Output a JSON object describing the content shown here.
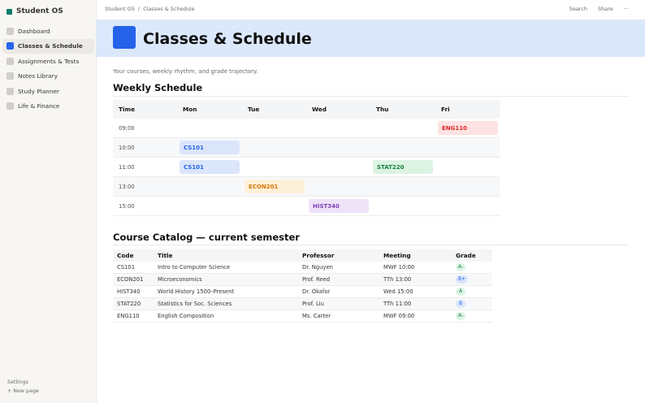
{
  "workspace": {
    "name": "Student OS"
  },
  "sidebar": {
    "items": [
      {
        "label": "Dashboard",
        "active": false
      },
      {
        "label": "Classes & Schedule",
        "active": true
      },
      {
        "label": "Assignments & Tests",
        "active": false
      },
      {
        "label": "Notes Library",
        "active": false
      },
      {
        "label": "Study Planner",
        "active": false
      },
      {
        "label": "Life & Finance",
        "active": false
      }
    ],
    "settings_label": "Settings",
    "new_page_label": "+  New page"
  },
  "topbar": {
    "breadcrumb": [
      "Student OS",
      "/",
      "Classes & Schedule"
    ],
    "search_label": "Search",
    "share_label": "Share",
    "more_label": "···"
  },
  "page": {
    "title": "Classes & Schedule",
    "subtitle": "Your courses, weekly rhythm, and grade trajectory."
  },
  "schedule": {
    "heading": "Weekly Schedule",
    "columns": [
      "Time",
      "Mon",
      "Tue",
      "Wed",
      "Thu",
      "Fri"
    ],
    "rows": [
      {
        "time": "09:00",
        "slots": [
          {
            "day": "Fri",
            "label": "ENG110",
            "color": "#dc2626",
            "bg": "#fde2e2"
          }
        ]
      },
      {
        "time": "10:00",
        "slots": [
          {
            "day": "Mon",
            "label": "CS101",
            "color": "#2563eb",
            "bg": "#dbe6fb"
          }
        ]
      },
      {
        "time": "11:00",
        "slots": [
          {
            "day": "Mon",
            "label": "CS101",
            "color": "#2563eb",
            "bg": "#dbe6fb"
          },
          {
            "day": "Thu",
            "label": "STAT220",
            "color": "#15803d",
            "bg": "#dcf3e3"
          }
        ]
      },
      {
        "time": "13:00",
        "slots": [
          {
            "day": "Tue",
            "label": "ECON201",
            "color": "#d97706",
            "bg": "#fdf0d8"
          }
        ]
      },
      {
        "time": "15:00",
        "slots": [
          {
            "day": "Wed",
            "label": "HIST340",
            "color": "#7e3fb8",
            "bg": "#efe3f8"
          }
        ]
      }
    ]
  },
  "catalog": {
    "heading": "Course Catalog — current semester",
    "columns": [
      "Code",
      "Title",
      "Professor",
      "Meeting",
      "Grade"
    ],
    "rows": [
      {
        "code": "CS101",
        "title": "Intro to Computer Science",
        "professor": "Dr. Nguyen",
        "meeting": "MWF 10:00",
        "grade": "A-",
        "grade_color": "#15803d",
        "grade_bg": "#dcf3e3"
      },
      {
        "code": "ECON201",
        "title": "Microeconomics",
        "professor": "Prof. Reed",
        "meeting": "TTh 13:00",
        "grade": "B+",
        "grade_color": "#2563eb",
        "grade_bg": "#dbe6fb"
      },
      {
        "code": "HIST340",
        "title": "World History 1500–Present",
        "professor": "Dr. Okafor",
        "meeting": "Wed 15:00",
        "grade": "A",
        "grade_color": "#15803d",
        "grade_bg": "#dcf3e3"
      },
      {
        "code": "STAT220",
        "title": "Statistics for Soc. Sciences",
        "professor": "Prof. Liu",
        "meeting": "TTh 11:00",
        "grade": "B",
        "grade_color": "#2563eb",
        "grade_bg": "#dbe6fb"
      },
      {
        "code": "ENG110",
        "title": "English Composition",
        "professor": "Ms. Carter",
        "meeting": "MWF 09:00",
        "grade": "A-",
        "grade_color": "#15803d",
        "grade_bg": "#dcf3e3"
      }
    ]
  }
}
